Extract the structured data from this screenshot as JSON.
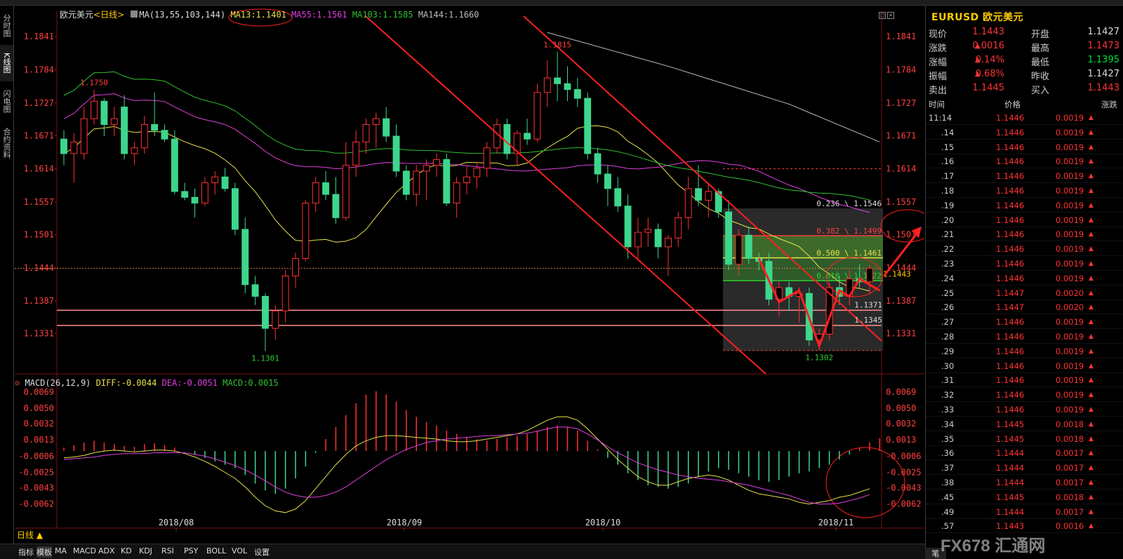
{
  "window": {
    "tabs_left": [
      {
        "label": "分时图"
      },
      {
        "label": "K线图"
      },
      {
        "label": "闪电图"
      },
      {
        "label": "合约资料"
      }
    ]
  },
  "chart_header": {
    "instrument": "欧元美元",
    "period": "<日线>",
    "ma_params": "MA(13,55,103,144)",
    "ma13": "MA13:1.1401",
    "ma55": "MA55:1.1561",
    "ma103": "MA103:1.1585",
    "ma144": "MA144:1.1660"
  },
  "macd_header": {
    "params": "MACD(26,12,9)",
    "diff": "DIFF:-0.0044",
    "dea": "DEA:-0.0051",
    "macd": "MACD:0.0015"
  },
  "colors": {
    "up": "#ff3030",
    "down": "#3dd68c",
    "ma13": "#e8e04a",
    "ma55": "#e040e0",
    "ma103": "#30c030",
    "ma144": "#bbbbbb",
    "accent": "#ffcc00"
  },
  "chart_data": [
    {
      "type": "candlestick",
      "title": "欧元美元 日线",
      "y_ticks": [
        "1.1841",
        "1.1784",
        "1.1727",
        "1.1671",
        "1.1614",
        "1.1557",
        "1.1501",
        "1.1444",
        "1.1387",
        "1.1331"
      ],
      "ylim": [
        1.128,
        1.187
      ],
      "x_labels": [
        "2018/08",
        "2018/09",
        "2018/10",
        "2018/11"
      ],
      "candles": [
        [
          1.1665,
          1.168,
          1.162,
          1.164
        ],
        [
          1.164,
          1.1675,
          1.159,
          1.166
        ],
        [
          1.164,
          1.172,
          1.163,
          1.17
        ],
        [
          1.17,
          1.175,
          1.169,
          1.173
        ],
        [
          1.173,
          1.1735,
          1.167,
          1.169
        ],
        [
          1.169,
          1.172,
          1.167,
          1.17
        ],
        [
          1.172,
          1.174,
          1.163,
          1.164
        ],
        [
          1.164,
          1.166,
          1.162,
          1.165
        ],
        [
          1.165,
          1.1705,
          1.164,
          1.169
        ],
        [
          1.169,
          1.1745,
          1.167,
          1.168
        ],
        [
          1.168,
          1.169,
          1.166,
          1.1665
        ],
        [
          1.1665,
          1.168,
          1.157,
          1.1575
        ],
        [
          1.1575,
          1.159,
          1.156,
          1.1565
        ],
        [
          1.1565,
          1.158,
          1.153,
          1.1555
        ],
        [
          1.1555,
          1.16,
          1.155,
          1.159
        ],
        [
          1.159,
          1.161,
          1.157,
          1.16
        ],
        [
          1.16,
          1.1615,
          1.1575,
          1.158
        ],
        [
          1.158,
          1.159,
          1.15,
          1.151
        ],
        [
          1.151,
          1.153,
          1.14,
          1.1415
        ],
        [
          1.1415,
          1.143,
          1.138,
          1.1395
        ],
        [
          1.1395,
          1.14,
          1.1301,
          1.134
        ],
        [
          1.134,
          1.138,
          1.132,
          1.137
        ],
        [
          1.137,
          1.144,
          1.135,
          1.143
        ],
        [
          1.143,
          1.147,
          1.141,
          1.146
        ],
        [
          1.146,
          1.156,
          1.1455,
          1.1555
        ],
        [
          1.1555,
          1.16,
          1.154,
          1.159
        ],
        [
          1.159,
          1.161,
          1.156,
          1.157
        ],
        [
          1.157,
          1.16,
          1.152,
          1.153
        ],
        [
          1.153,
          1.166,
          1.1525,
          1.162
        ],
        [
          1.162,
          1.168,
          1.16,
          1.166
        ],
        [
          1.166,
          1.17,
          1.164,
          1.169
        ],
        [
          1.169,
          1.171,
          1.165,
          1.17
        ],
        [
          1.17,
          1.172,
          1.166,
          1.167
        ],
        [
          1.167,
          1.169,
          1.16,
          1.161
        ],
        [
          1.161,
          1.162,
          1.156,
          1.157
        ],
        [
          1.157,
          1.162,
          1.155,
          1.161
        ],
        [
          1.161,
          1.163,
          1.156,
          1.162
        ],
        [
          1.162,
          1.164,
          1.16,
          1.163
        ],
        [
          1.163,
          1.164,
          1.155,
          1.1555
        ],
        [
          1.1555,
          1.16,
          1.153,
          1.159
        ],
        [
          1.159,
          1.162,
          1.157,
          1.16
        ],
        [
          1.16,
          1.1625,
          1.158,
          1.1615
        ],
        [
          1.1615,
          1.166,
          1.16,
          1.165
        ],
        [
          1.165,
          1.17,
          1.164,
          1.169
        ],
        [
          1.169,
          1.17,
          1.163,
          1.164
        ],
        [
          1.164,
          1.168,
          1.162,
          1.1675
        ],
        [
          1.1675,
          1.17,
          1.1655,
          1.1665
        ],
        [
          1.1665,
          1.176,
          1.166,
          1.1745
        ],
        [
          1.1745,
          1.18,
          1.172,
          1.177
        ],
        [
          1.177,
          1.1815,
          1.173,
          1.176
        ],
        [
          1.176,
          1.179,
          1.173,
          1.175
        ],
        [
          1.175,
          1.177,
          1.172,
          1.1735
        ],
        [
          1.1735,
          1.1745,
          1.163,
          1.164
        ],
        [
          1.164,
          1.165,
          1.159,
          1.1605
        ],
        [
          1.1605,
          1.162,
          1.155,
          1.158
        ],
        [
          1.158,
          1.16,
          1.154,
          1.155
        ],
        [
          1.155,
          1.157,
          1.146,
          1.148
        ],
        [
          1.148,
          1.153,
          1.146,
          1.1505
        ],
        [
          1.1505,
          1.153,
          1.148,
          1.151
        ],
        [
          1.151,
          1.152,
          1.146,
          1.148
        ],
        [
          1.148,
          1.15,
          1.143,
          1.1495
        ],
        [
          1.1495,
          1.154,
          1.148,
          1.153
        ],
        [
          1.153,
          1.16,
          1.151,
          1.158
        ],
        [
          1.158,
          1.162,
          1.155,
          1.156
        ],
        [
          1.156,
          1.159,
          1.153,
          1.1575
        ],
        [
          1.1575,
          1.158,
          1.153,
          1.154
        ],
        [
          1.154,
          1.156,
          1.144,
          1.145
        ],
        [
          1.145,
          1.151,
          1.143,
          1.15
        ],
        [
          1.15,
          1.1515,
          1.145,
          1.146
        ],
        [
          1.146,
          1.147,
          1.144,
          1.1455
        ],
        [
          1.1455,
          1.147,
          1.138,
          1.139
        ],
        [
          1.139,
          1.142,
          1.136,
          1.141
        ],
        [
          1.141,
          1.142,
          1.137,
          1.1395
        ],
        [
          1.1395,
          1.141,
          1.135,
          1.14
        ],
        [
          1.14,
          1.141,
          1.131,
          1.132
        ],
        [
          1.132,
          1.134,
          1.1302,
          1.133
        ],
        [
          1.133,
          1.142,
          1.132,
          1.141
        ],
        [
          1.141,
          1.143,
          1.138,
          1.1395
        ],
        [
          1.1395,
          1.144,
          1.138,
          1.1425
        ],
        [
          1.1425,
          1.145,
          1.141,
          1.142
        ],
        [
          1.142,
          1.145,
          1.14,
          1.1443
        ]
      ],
      "price_labels": [
        {
          "text": "1.1750",
          "value": 1.175
        },
        {
          "text": "1.1301",
          "value": 1.1301
        },
        {
          "text": "1.1815",
          "value": 1.1815
        },
        {
          "text": "1.1302",
          "value": 1.1302
        },
        {
          "text": "1.1371",
          "value": 1.1371
        },
        {
          "text": "1.1345",
          "value": 1.1345
        }
      ],
      "fib_levels": [
        {
          "text": "0.236 \\ 1.1546",
          "value": 1.1546
        },
        {
          "text": "0.382 \\ 1.1499",
          "value": 1.1499
        },
        {
          "text": "0.500 \\ 1.1461",
          "value": 1.1461
        },
        {
          "text": "0.618 \\ 1.1422",
          "value": 1.1422
        }
      ],
      "current_price_tag": "1.1443",
      "horizontal_lines": [
        1.1371,
        1.1345
      ],
      "ma_series": [
        {
          "name": "MA13"
        },
        {
          "name": "MA55"
        },
        {
          "name": "MA103"
        },
        {
          "name": "MA144"
        }
      ]
    },
    {
      "type": "bar",
      "title": "MACD(26,12,9)",
      "y_ticks": [
        "0.0069",
        "0.0050",
        "0.0032",
        "0.0013",
        "-0.0006",
        "-0.0025",
        "-0.0043",
        "-0.0062"
      ],
      "ylim": [
        -0.0082,
        0.0078
      ],
      "macd_hist": [
        0.0004,
        0.0007,
        0.001,
        0.0012,
        0.001,
        0.0008,
        0.0006,
        0.0005,
        0.0008,
        0.0009,
        0.0007,
        0.0004,
        0.0,
        -0.0004,
        -0.0008,
        -0.0012,
        -0.0016,
        -0.002,
        -0.0028,
        -0.0038,
        -0.0046,
        -0.005,
        -0.0044,
        -0.0032,
        -0.0018,
        -0.0002,
        0.0014,
        0.0028,
        0.0042,
        0.0056,
        0.0066,
        0.007,
        0.0066,
        0.0058,
        0.0048,
        0.004,
        0.0034,
        0.003,
        0.0024,
        0.002,
        0.0016,
        0.0014,
        0.0012,
        0.0014,
        0.0016,
        0.0018,
        0.002,
        0.0024,
        0.0028,
        0.003,
        0.0028,
        0.0024,
        0.0012,
        0.0002,
        -0.0008,
        -0.0016,
        -0.0026,
        -0.0034,
        -0.004,
        -0.0042,
        -0.0044,
        -0.0042,
        -0.0038,
        -0.003,
        -0.0024,
        -0.002,
        -0.0022,
        -0.0026,
        -0.003,
        -0.0034,
        -0.0036,
        -0.0034,
        -0.003,
        -0.0026,
        -0.0024,
        -0.002,
        -0.0016,
        -0.001,
        -0.0004,
        0.0004,
        0.001,
        0.0015
      ],
      "diff": [
        -0.0008,
        -0.0007,
        -0.0005,
        -0.0002,
        0.0,
        0.0001,
        0.0,
        -0.0001,
        0.0,
        0.0001,
        0.0001,
        0.0,
        -0.0003,
        -0.0007,
        -0.0012,
        -0.0018,
        -0.0025,
        -0.0032,
        -0.0042,
        -0.0054,
        -0.0064,
        -0.007,
        -0.0072,
        -0.0068,
        -0.0058,
        -0.0044,
        -0.003,
        -0.0016,
        -0.0004,
        0.0006,
        0.0012,
        0.0016,
        0.0018,
        0.0018,
        0.0017,
        0.0016,
        0.0015,
        0.0014,
        0.0012,
        0.0011,
        0.0011,
        0.0012,
        0.0014,
        0.0016,
        0.0018,
        0.002,
        0.0024,
        0.003,
        0.0036,
        0.004,
        0.004,
        0.0036,
        0.0026,
        0.0014,
        0.0002,
        -0.001,
        -0.002,
        -0.003,
        -0.0036,
        -0.004,
        -0.004,
        -0.0036,
        -0.0032,
        -0.003,
        -0.0028,
        -0.003,
        -0.0034,
        -0.004,
        -0.0046,
        -0.005,
        -0.0052,
        -0.0054,
        -0.0056,
        -0.006,
        -0.0062,
        -0.006,
        -0.0058,
        -0.0054,
        -0.0052,
        -0.0048,
        -0.0044
      ],
      "dea": [
        -0.001,
        -0.0009,
        -0.0008,
        -0.0007,
        -0.0005,
        -0.0004,
        -0.0003,
        -0.0003,
        -0.0003,
        -0.0002,
        -0.0002,
        -0.0002,
        -0.0002,
        -0.0004,
        -0.0006,
        -0.0009,
        -0.0013,
        -0.0017,
        -0.0022,
        -0.0028,
        -0.0035,
        -0.0042,
        -0.0048,
        -0.0052,
        -0.0054,
        -0.0054,
        -0.0052,
        -0.0048,
        -0.0042,
        -0.0034,
        -0.0026,
        -0.0018,
        -0.001,
        -0.0004,
        0.0002,
        0.0006,
        0.001,
        0.0012,
        0.0014,
        0.0015,
        0.0016,
        0.0017,
        0.0018,
        0.0018,
        0.0019,
        0.002,
        0.0021,
        0.0023,
        0.0026,
        0.0028,
        0.0028,
        0.0026,
        0.002,
        0.0013,
        0.0005,
        -0.0002,
        -0.0008,
        -0.0014,
        -0.0018,
        -0.0022,
        -0.0025,
        -0.0028,
        -0.003,
        -0.0032,
        -0.0033,
        -0.0034,
        -0.0036,
        -0.0038,
        -0.004,
        -0.0043,
        -0.0046,
        -0.0049,
        -0.0052,
        -0.0056,
        -0.006,
        -0.0062,
        -0.0062,
        -0.0061,
        -0.0058,
        -0.0055,
        -0.0051
      ]
    }
  ],
  "quote": {
    "symbol": "EURUSD",
    "name": "欧元美元",
    "rows": [
      {
        "l1": "现价",
        "v1": "1.1443",
        "l2": "开盘",
        "v2": "1.1427"
      },
      {
        "l1": "涨跌",
        "v1": "0.0016",
        "l2": "最高",
        "v2": "1.1473"
      },
      {
        "l1": "涨幅",
        "v1": "0.14%",
        "l2": "最低",
        "v2": "1.1395"
      },
      {
        "l1": "振幅",
        "v1": "0.68%",
        "l2": "昨收",
        "v2": "1.1427"
      },
      {
        "l1": "卖出",
        "v1": "1.1445",
        "l2": "买入",
        "v2": "1.1443"
      }
    ],
    "tick_header": {
      "time": "时间",
      "price": "价格",
      "change": "涨跌"
    },
    "ticks": [
      {
        "t": "11:14",
        "p": "1.1446",
        "c": "0.0019"
      },
      {
        "t": ".14",
        "p": "1.1446",
        "c": "0.0019"
      },
      {
        "t": ".15",
        "p": "1.1446",
        "c": "0.0019"
      },
      {
        "t": ".16",
        "p": "1.1446",
        "c": "0.0019"
      },
      {
        "t": ".17",
        "p": "1.1446",
        "c": "0.0019"
      },
      {
        "t": ".18",
        "p": "1.1446",
        "c": "0.0019"
      },
      {
        "t": ".19",
        "p": "1.1446",
        "c": "0.0019"
      },
      {
        "t": ".20",
        "p": "1.1446",
        "c": "0.0019"
      },
      {
        "t": ".21",
        "p": "1.1446",
        "c": "0.0019"
      },
      {
        "t": ".22",
        "p": "1.1446",
        "c": "0.0019"
      },
      {
        "t": ".23",
        "p": "1.1446",
        "c": "0.0019"
      },
      {
        "t": ".24",
        "p": "1.1446",
        "c": "0.0019"
      },
      {
        "t": ".25",
        "p": "1.1447",
        "c": "0.0020"
      },
      {
        "t": ".26",
        "p": "1.1447",
        "c": "0.0020"
      },
      {
        "t": ".27",
        "p": "1.1446",
        "c": "0.0019"
      },
      {
        "t": ".28",
        "p": "1.1446",
        "c": "0.0019"
      },
      {
        "t": ".29",
        "p": "1.1446",
        "c": "0.0019"
      },
      {
        "t": ".30",
        "p": "1.1446",
        "c": "0.0019"
      },
      {
        "t": ".31",
        "p": "1.1446",
        "c": "0.0019"
      },
      {
        "t": ".32",
        "p": "1.1446",
        "c": "0.0019"
      },
      {
        "t": ".33",
        "p": "1.1446",
        "c": "0.0019"
      },
      {
        "t": ".34",
        "p": "1.1445",
        "c": "0.0018"
      },
      {
        "t": ".35",
        "p": "1.1445",
        "c": "0.0018"
      },
      {
        "t": ".36",
        "p": "1.1444",
        "c": "0.0017"
      },
      {
        "t": ".37",
        "p": "1.1444",
        "c": "0.0017"
      },
      {
        "t": ".38",
        "p": "1.1444",
        "c": "0.0017"
      },
      {
        "t": ".45",
        "p": "1.1445",
        "c": "0.0018"
      },
      {
        "t": ".49",
        "p": "1.1444",
        "c": "0.0017"
      },
      {
        "t": ".57",
        "p": "1.1443",
        "c": "0.0016"
      }
    ]
  },
  "bottom": {
    "period_label": "日线",
    "tabs": [
      "指标",
      "模板",
      "MA",
      "MACD",
      "ADX",
      "KD",
      "KDJ",
      "RSI",
      "PSY",
      "BOLL",
      "VOL",
      "设置"
    ],
    "right_tab": "笔"
  },
  "watermark": "FX678 汇通网"
}
